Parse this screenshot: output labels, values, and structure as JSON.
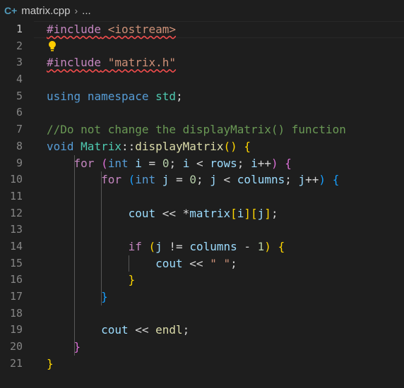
{
  "breadcrumb": {
    "file_icon": "C+",
    "file_name": "matrix.cpp",
    "separator": "›",
    "more": "..."
  },
  "lines": [
    {
      "number": "1",
      "tokens": [
        {
          "t": "#include",
          "c": "tok-pp squiggle"
        },
        {
          "t": " ",
          "c": "tok-op squiggle"
        },
        {
          "t": "<iostream>",
          "c": "tok-str squiggle"
        }
      ]
    },
    {
      "number": "2",
      "tokens": []
    },
    {
      "number": "3",
      "tokens": [
        {
          "t": "#include",
          "c": "tok-pp squiggle"
        },
        {
          "t": " ",
          "c": "tok-op squiggle"
        },
        {
          "t": "\"matrix.h\"",
          "c": "tok-str squiggle"
        }
      ]
    },
    {
      "number": "4",
      "tokens": []
    },
    {
      "number": "5",
      "tokens": [
        {
          "t": "using",
          "c": "tok-kw"
        },
        {
          "t": " ",
          "c": "tok-op"
        },
        {
          "t": "namespace",
          "c": "tok-kw"
        },
        {
          "t": " ",
          "c": "tok-op"
        },
        {
          "t": "std",
          "c": "tok-type"
        },
        {
          "t": ";",
          "c": "tok-op"
        }
      ]
    },
    {
      "number": "6",
      "tokens": []
    },
    {
      "number": "7",
      "tokens": [
        {
          "t": "//Do not change the displayMatrix() function",
          "c": "tok-cmt"
        }
      ]
    },
    {
      "number": "8",
      "tokens": [
        {
          "t": "void",
          "c": "tok-kw"
        },
        {
          "t": " ",
          "c": "tok-op"
        },
        {
          "t": "Matrix",
          "c": "tok-type"
        },
        {
          "t": "::",
          "c": "tok-op"
        },
        {
          "t": "displayMatrix",
          "c": "tok-fn"
        },
        {
          "t": "()",
          "c": "b1"
        },
        {
          "t": " ",
          "c": "tok-op"
        },
        {
          "t": "{",
          "c": "b1"
        }
      ]
    },
    {
      "number": "9",
      "tokens": [
        {
          "t": "    ",
          "c": "tok-op"
        },
        {
          "t": "for",
          "c": "tok-ctl"
        },
        {
          "t": " ",
          "c": "tok-op"
        },
        {
          "t": "(",
          "c": "b2"
        },
        {
          "t": "int",
          "c": "tok-kw"
        },
        {
          "t": " ",
          "c": "tok-op"
        },
        {
          "t": "i",
          "c": "tok-var"
        },
        {
          "t": " = ",
          "c": "tok-op"
        },
        {
          "t": "0",
          "c": "tok-num"
        },
        {
          "t": "; ",
          "c": "tok-op"
        },
        {
          "t": "i",
          "c": "tok-var"
        },
        {
          "t": " < ",
          "c": "tok-op"
        },
        {
          "t": "rows",
          "c": "tok-var"
        },
        {
          "t": "; ",
          "c": "tok-op"
        },
        {
          "t": "i",
          "c": "tok-var"
        },
        {
          "t": "++",
          "c": "tok-op"
        },
        {
          "t": ")",
          "c": "b2"
        },
        {
          "t": " ",
          "c": "tok-op"
        },
        {
          "t": "{",
          "c": "b2"
        }
      ]
    },
    {
      "number": "10",
      "tokens": [
        {
          "t": "        ",
          "c": "tok-op"
        },
        {
          "t": "for",
          "c": "tok-ctl"
        },
        {
          "t": " ",
          "c": "tok-op"
        },
        {
          "t": "(",
          "c": "b3"
        },
        {
          "t": "int",
          "c": "tok-kw"
        },
        {
          "t": " ",
          "c": "tok-op"
        },
        {
          "t": "j",
          "c": "tok-var"
        },
        {
          "t": " = ",
          "c": "tok-op"
        },
        {
          "t": "0",
          "c": "tok-num"
        },
        {
          "t": "; ",
          "c": "tok-op"
        },
        {
          "t": "j",
          "c": "tok-var"
        },
        {
          "t": " < ",
          "c": "tok-op"
        },
        {
          "t": "columns",
          "c": "tok-var"
        },
        {
          "t": "; ",
          "c": "tok-op"
        },
        {
          "t": "j",
          "c": "tok-var"
        },
        {
          "t": "++",
          "c": "tok-op"
        },
        {
          "t": ")",
          "c": "b3"
        },
        {
          "t": " ",
          "c": "tok-op"
        },
        {
          "t": "{",
          "c": "b3"
        }
      ]
    },
    {
      "number": "11",
      "tokens": []
    },
    {
      "number": "12",
      "tokens": [
        {
          "t": "            ",
          "c": "tok-op"
        },
        {
          "t": "cout",
          "c": "tok-var"
        },
        {
          "t": " << *",
          "c": "tok-op"
        },
        {
          "t": "matrix",
          "c": "tok-var"
        },
        {
          "t": "[",
          "c": "b1"
        },
        {
          "t": "i",
          "c": "tok-var"
        },
        {
          "t": "]",
          "c": "b1"
        },
        {
          "t": "[",
          "c": "b1"
        },
        {
          "t": "j",
          "c": "tok-var"
        },
        {
          "t": "]",
          "c": "b1"
        },
        {
          "t": ";",
          "c": "tok-op"
        }
      ]
    },
    {
      "number": "13",
      "tokens": []
    },
    {
      "number": "14",
      "tokens": [
        {
          "t": "            ",
          "c": "tok-op"
        },
        {
          "t": "if",
          "c": "tok-ctl"
        },
        {
          "t": " ",
          "c": "tok-op"
        },
        {
          "t": "(",
          "c": "b1"
        },
        {
          "t": "j",
          "c": "tok-var"
        },
        {
          "t": " != ",
          "c": "tok-op"
        },
        {
          "t": "columns",
          "c": "tok-var"
        },
        {
          "t": " - ",
          "c": "tok-op"
        },
        {
          "t": "1",
          "c": "tok-num"
        },
        {
          "t": ")",
          "c": "b1"
        },
        {
          "t": " ",
          "c": "tok-op"
        },
        {
          "t": "{",
          "c": "b1"
        }
      ]
    },
    {
      "number": "15",
      "tokens": [
        {
          "t": "                ",
          "c": "tok-op"
        },
        {
          "t": "cout",
          "c": "tok-var"
        },
        {
          "t": " << ",
          "c": "tok-op"
        },
        {
          "t": "\" \"",
          "c": "tok-str"
        },
        {
          "t": ";",
          "c": "tok-op"
        }
      ]
    },
    {
      "number": "16",
      "tokens": [
        {
          "t": "            ",
          "c": "tok-op"
        },
        {
          "t": "}",
          "c": "b1"
        }
      ]
    },
    {
      "number": "17",
      "tokens": [
        {
          "t": "        ",
          "c": "tok-op"
        },
        {
          "t": "}",
          "c": "b3"
        }
      ]
    },
    {
      "number": "18",
      "tokens": []
    },
    {
      "number": "19",
      "tokens": [
        {
          "t": "        ",
          "c": "tok-op"
        },
        {
          "t": "cout",
          "c": "tok-var"
        },
        {
          "t": " << ",
          "c": "tok-op"
        },
        {
          "t": "endl",
          "c": "tok-fn"
        },
        {
          "t": ";",
          "c": "tok-op"
        }
      ]
    },
    {
      "number": "20",
      "tokens": [
        {
          "t": "    ",
          "c": "tok-op"
        },
        {
          "t": "}",
          "c": "b2"
        }
      ]
    },
    {
      "number": "21",
      "tokens": [
        {
          "t": "}",
          "c": "b1"
        }
      ]
    }
  ],
  "current_line": "1",
  "lightbulb_line": "2",
  "icons": {
    "lightbulb": "lightbulb-icon",
    "file": "cpp-file-icon"
  },
  "colors": {
    "background": "#1e1e1e",
    "lightbulb": "#ffcc00",
    "error_squiggle": "#f14c4c"
  }
}
